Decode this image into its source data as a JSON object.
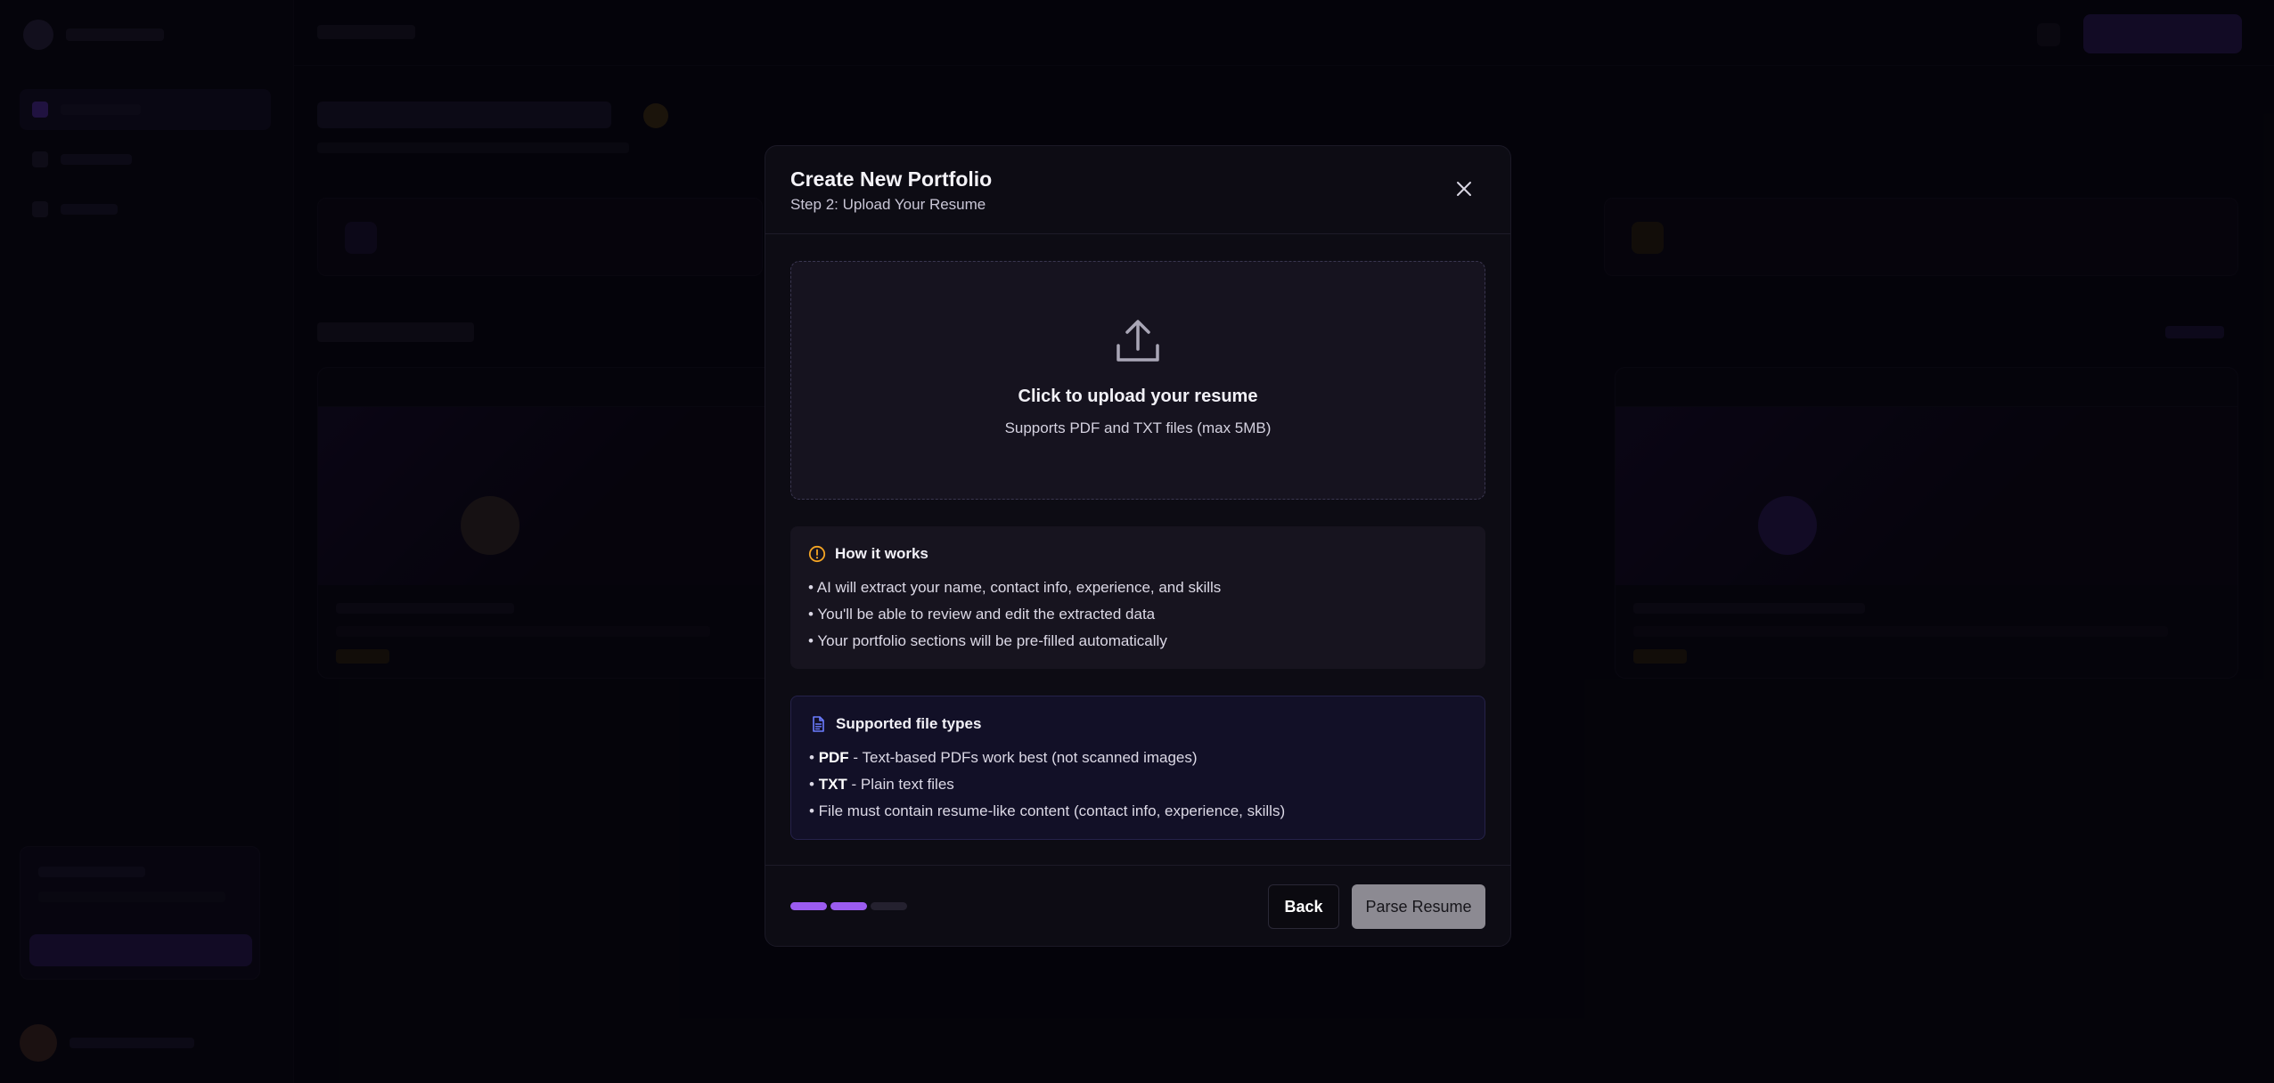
{
  "modal": {
    "title": "Create New Portfolio",
    "subtitle": "Step 2: Upload Your Resume",
    "close_icon": "close-icon"
  },
  "upload": {
    "icon": "upload-icon",
    "title": "Click to upload your resume",
    "subtitle": "Supports PDF and TXT files (max 5MB)"
  },
  "how_it_works": {
    "icon": "alert-circle-icon",
    "icon_color": "#f5a524",
    "title": "How it works",
    "items": [
      "• AI will extract your name, contact info, experience, and skills",
      "• You'll be able to review and edit the extracted data",
      "• Your portfolio sections will be pre-filled automatically"
    ]
  },
  "file_types": {
    "icon": "document-icon",
    "icon_color": "#6b7cff",
    "title": "Supported file types",
    "items": [
      {
        "bullet": "• ",
        "label": "PDF",
        "text": " - Text-based PDFs work best (not scanned images)"
      },
      {
        "bullet": "• ",
        "label": "TXT",
        "text": " - Plain text files"
      },
      {
        "bullet": "",
        "label": "",
        "text": "• File must contain resume-like content (contact info, experience, skills)"
      }
    ]
  },
  "footer": {
    "steps_total": 3,
    "steps_completed": 2,
    "back_label": "Back",
    "parse_label": "Parse Resume"
  },
  "colors": {
    "accent": "#9b5cf0",
    "modal_bg": "#0d0c14",
    "disabled_button": "#8c8a92"
  }
}
